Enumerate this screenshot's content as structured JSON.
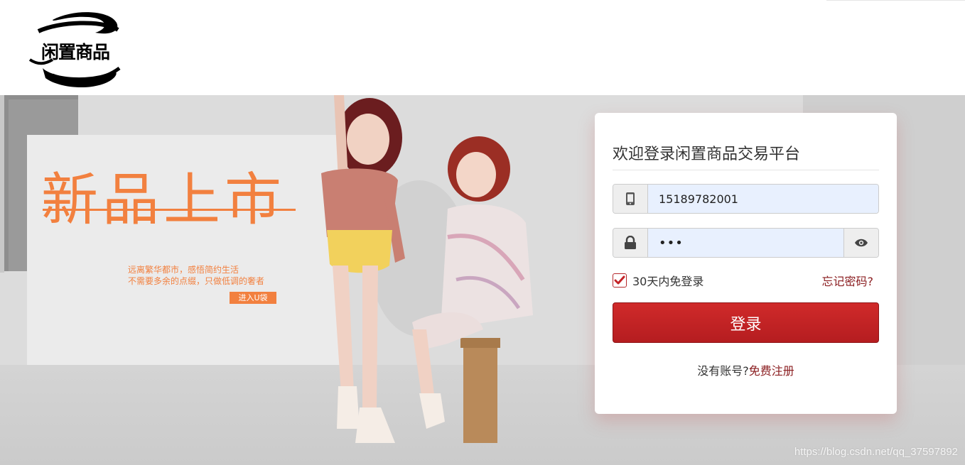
{
  "header": {
    "logo_text": "闲置商品"
  },
  "banner": {
    "promo_title": "新品上市",
    "promo_line1": "远离繁华都市，感悟简约生活",
    "promo_line2": "不需要多余的点缀，只做低调的奢者",
    "promo_button": "进入U袋"
  },
  "login": {
    "title": "欢迎登录闲置商品交易平台",
    "phone": {
      "icon": "mobile-phone-icon",
      "value": "15189782001"
    },
    "password": {
      "icon": "lock-icon",
      "value": "•••",
      "toggle_icon": "eye-icon"
    },
    "remember_label": "30天内免登录",
    "remember_checked": true,
    "forgot_label": "忘记密码?",
    "submit_label": "登录",
    "register_prompt": "没有账号?",
    "register_link": "免费注册"
  },
  "watermark": "https://blog.csdn.net/qq_37597892",
  "colors": {
    "accent": "#c42326",
    "link": "#8a1c1f",
    "promo": "#f2803f",
    "input_bg": "#e8f0fe"
  }
}
